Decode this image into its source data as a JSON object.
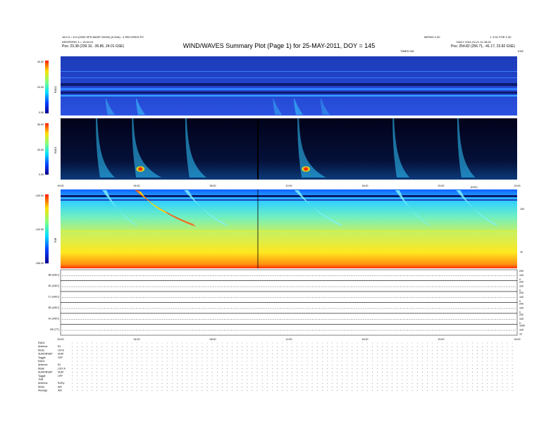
{
  "header": {
    "title": "WIND/WAVES Summary Plot (Page 1) for 25-MAY-2011, DOY = 145",
    "left_lines": [
      "16:0.0 = 6.H (2000 SPH MASP 20000) (0.00A) - 4 RECORDS PC",
      "ARGPERIG 3 = 13:04.01",
      "Pos:   23.38 (239.10, -35.86, 24.01 GSE)"
    ],
    "right_top": "IMF000 2.40",
    "right_top2": "L 3.91 FOR 2.40",
    "right_line2": "DAILY 2011-02-21 11:18:32",
    "right_pos": "Pos:   254.82 (256.71, -41.17, 23.82 GSE)",
    "mid_label": "TIMES KM",
    "mid_right_label": "(KHZ)",
    "freq_label": "KHZ"
  },
  "chart_data": [
    {
      "type": "heatmap",
      "name": "RAD2",
      "ylabel": "RAD2",
      "colorbar_ticks": [
        "40.00",
        "20.00",
        "0.00"
      ],
      "xlim": [
        0,
        24
      ],
      "bursts": [
        {
          "t": 2.4,
          "intensity": 0.45
        },
        {
          "t": 4.0,
          "intensity": 0.55
        },
        {
          "t": 11.2,
          "intensity": 0.4
        },
        {
          "t": 12.3,
          "intensity": 0.55
        },
        {
          "t": 13.7,
          "intensity": 0.35
        }
      ]
    },
    {
      "type": "heatmap",
      "name": "RAD1",
      "ylabel": "RAD1",
      "colorbar_ticks": [
        "50.00",
        "30.00",
        "0.00"
      ],
      "xlim": [
        0,
        24
      ],
      "xticks": [
        "00:00",
        "04:00",
        "08:00",
        "12:00",
        "16:00",
        "20:00",
        "24:00"
      ],
      "bursts": [
        {
          "t": 2.0,
          "intensity": 0.5
        },
        {
          "t": 3.9,
          "intensity": 1.0
        },
        {
          "t": 6.7,
          "intensity": 0.6
        },
        {
          "t": 12.6,
          "intensity": 0.95
        },
        {
          "t": 17.6,
          "intensity": 0.4
        },
        {
          "t": 21.0,
          "intensity": 0.45
        }
      ]
    },
    {
      "type": "heatmap",
      "name": "TNR",
      "ylabel": "TNR",
      "colorbar_ticks": [
        "-130.00",
        "-142.50",
        "-155.00"
      ],
      "right_ticks": [
        "100",
        "10"
      ],
      "xlim": [
        0,
        24
      ],
      "bursts": [
        {
          "t": 2.3,
          "intensity": 0.4
        },
        {
          "t": 4.0,
          "intensity": 1.0
        },
        {
          "t": 6.6,
          "intensity": 0.6
        },
        {
          "t": 12.4,
          "intensity": 0.7
        },
        {
          "t": 17.7,
          "intensity": 0.4
        },
        {
          "t": 20.9,
          "intensity": 0.55
        }
      ]
    },
    {
      "type": "line",
      "name": "housekeeping",
      "xticks": [
        "00:00",
        "04:00",
        "08:00",
        "12:00",
        "16:00",
        "20:00",
        "24:00"
      ],
      "panels": [
        {
          "label": "B0 (ADC)",
          "ticks": [
            "200",
            "100",
            "0"
          ]
        },
        {
          "label": "B1 (ADC)",
          "ticks": [
            "200",
            "100",
            "0"
          ]
        },
        {
          "label": "C1 (ADC)",
          "ticks": [
            "200",
            "100",
            "0"
          ]
        },
        {
          "label": "B2 (ADC)",
          "ticks": [
            "200",
            "100",
            "0"
          ]
        },
        {
          "label": "A1 (ADC)",
          "ticks": [
            "200",
            "100",
            "0"
          ]
        },
        {
          "label": "BS (TT)",
          "ticks": [
            "1000",
            "100",
            "10"
          ]
        }
      ]
    }
  ],
  "footer": {
    "rows": [
      {
        "k": "RAD2",
        "v": ""
      },
      {
        "k": "Antenna",
        "v": "Ex"
      },
      {
        "k": "Mode",
        "v": "LIN 8"
      },
      {
        "k": "SUMORSEP",
        "v": "SUM"
      },
      {
        "k": "Toggle",
        "v": "OFF"
      },
      {
        "k": "RAD1",
        "v": ""
      },
      {
        "k": "Antenna",
        "v": "Ex"
      },
      {
        "k": "Mode",
        "v": "LIST A"
      },
      {
        "k": "SUMORSEP",
        "v": "SUM"
      },
      {
        "k": "Toggle",
        "v": "OFF"
      },
      {
        "k": "TNR",
        "v": ""
      },
      {
        "k": "Antenna",
        "v": "Ex/Ey"
      },
      {
        "k": "Mode",
        "v": "A/D"
      },
      {
        "k": "Average",
        "v": "A/D"
      }
    ]
  },
  "colors": {
    "background_panel": "#1c3fd0",
    "bar_dark": "#0a1a70",
    "burst_hot": "#ff2a00"
  }
}
